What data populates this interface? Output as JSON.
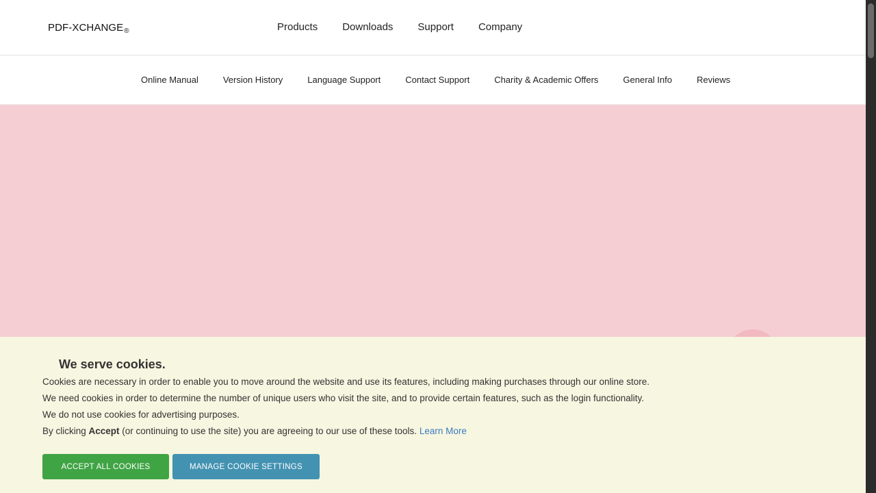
{
  "header": {
    "logo_text": "PDF-XCHANGE",
    "logo_reg": "®",
    "nav": [
      "Products",
      "Downloads",
      "Support",
      "Company"
    ]
  },
  "subnav": {
    "items": [
      "Online Manual",
      "Version History",
      "Language Support",
      "Contact Support",
      "Charity & Academic Offers",
      "General Info",
      "Reviews"
    ]
  },
  "colors": {
    "hero_bg": "#f5ced4",
    "banner_bg": "#f7f6e1",
    "accept_bg": "#3fa444",
    "manage_bg": "#4392b1",
    "link": "#3b7bbf"
  },
  "cookie": {
    "title": "We serve cookies.",
    "line1": "Cookies are necessary in order to enable you to move around the website and use its features, including making purchases through our online store.",
    "line2": "We need cookies in order to determine the number of unique users who visit the site, and to provide certain features, such as the login functionality.",
    "line3": "We do not use cookies for advertising purposes.",
    "line4_prefix": "By clicking ",
    "line4_bold": "Accept",
    "line4_suffix": " (or continuing to use the site) you are agreeing to our use of these tools. ",
    "learn_more": "Learn More",
    "accept_label": "ACCEPT ALL COOKIES",
    "manage_label": "MANAGE COOKIE SETTINGS"
  }
}
